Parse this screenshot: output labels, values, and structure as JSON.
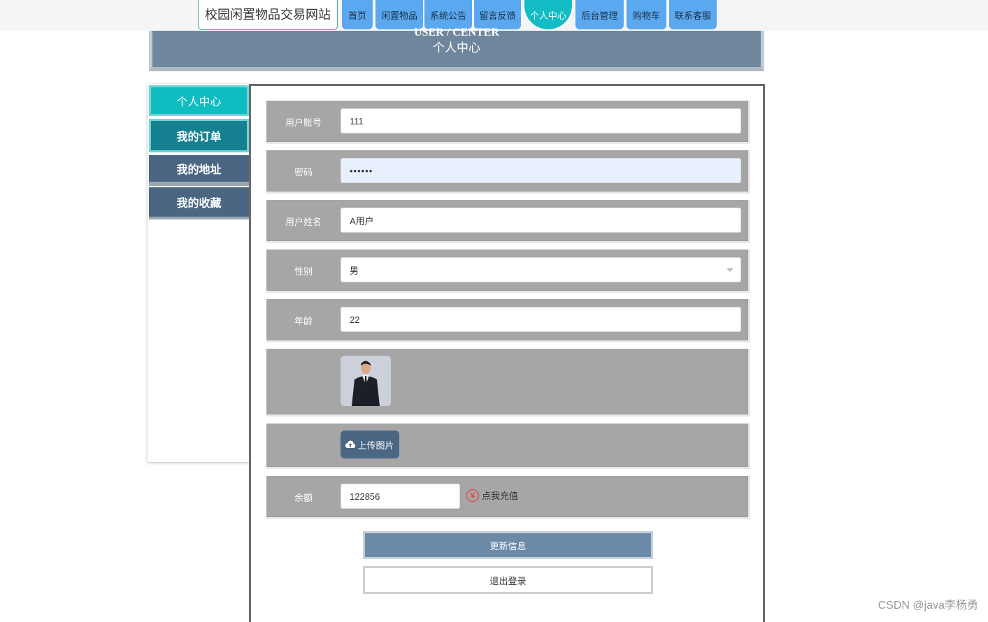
{
  "nav": {
    "site_title": "校园闲置物品交易网站",
    "items": [
      {
        "label": "首页"
      },
      {
        "label": "闲置物品"
      },
      {
        "label": "系统公告"
      },
      {
        "label": "留言反馈"
      },
      {
        "label": "个人中心"
      },
      {
        "label": "后台管理"
      },
      {
        "label": "购物车"
      },
      {
        "label": "联系客服"
      }
    ],
    "active_index": 4
  },
  "banner": {
    "en_title": "USER / CENTER",
    "cn_title": "个人中心"
  },
  "sidebar": {
    "items": [
      {
        "label": "个人中心"
      },
      {
        "label": "我的订单"
      },
      {
        "label": "我的地址"
      },
      {
        "label": "我的收藏"
      }
    ]
  },
  "form": {
    "account": {
      "label": "用户账号",
      "value": "111"
    },
    "password": {
      "label": "密码",
      "value": "••••••"
    },
    "name": {
      "label": "用户姓名",
      "value": "A用户"
    },
    "gender": {
      "label": "性别",
      "value": "男"
    },
    "age": {
      "label": "年龄",
      "value": "22"
    },
    "upload_label": "上传图片",
    "balance": {
      "label": "余额",
      "value": "122856"
    },
    "recharge_label": "点我充值",
    "yen_symbol": "¥"
  },
  "buttons": {
    "update": "更新信息",
    "logout": "退出登录"
  },
  "watermark": "CSDN @java李杨勇",
  "colors": {
    "nav_blue": "#5aa8f0",
    "nav_active": "#12bcc4",
    "banner": "#6e879c",
    "row_gray": "#a6a6a6",
    "sidebar_dark": "#4a6682"
  }
}
